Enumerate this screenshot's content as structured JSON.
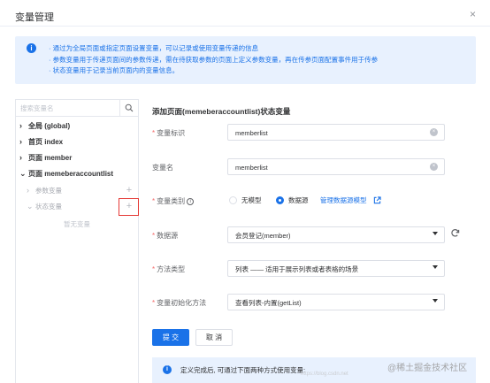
{
  "dialog": {
    "title": "变量管理",
    "close_glyph": "×"
  },
  "info": {
    "icon_glyph": "i",
    "lines": [
      "· 通过为全局页面或指定页面设置变量，可以记录或使用变量传递的信息",
      "· 参数变量用于传递页面间的参数传递，需在待获取参数的页面上定义参数变量，再在传参页面配置事件用于传参",
      "· 状态变量用于记录当前页面内的变量信息。"
    ]
  },
  "tree": {
    "search_placeholder": "搜索变量名",
    "nodes": [
      {
        "arrow": "›",
        "label": "全局 (global)"
      },
      {
        "arrow": "›",
        "label": "首页 index"
      },
      {
        "arrow": "›",
        "label": "页面 member"
      },
      {
        "arrow": "⌄",
        "label": "页面 memeberaccountlist"
      }
    ],
    "children": [
      {
        "arrow": "›",
        "label": "参数变量",
        "plus": "+"
      },
      {
        "arrow": "⌄",
        "label": "状态变量",
        "plus": "+"
      }
    ],
    "empty_text": "暂无变量"
  },
  "form": {
    "title": "添加页面(memeberaccountlist)状态变量",
    "required_mark": "*",
    "fields": {
      "identifier": {
        "label": "变量标识",
        "value": "memberlist"
      },
      "name": {
        "label": "变量名",
        "value": "memberlist"
      },
      "category": {
        "label": "变量类别",
        "options": [
          "无模型",
          "数据源"
        ],
        "selected": "数据源",
        "link": "管理数据源模型"
      },
      "datasource": {
        "label": "数据源",
        "value": "会员登记(member)"
      },
      "method": {
        "label": "方法类型",
        "value": "列表 —— 适用于展示列表或者表格的场景"
      },
      "init": {
        "label": "变量初始化方法",
        "value": "查看列表-内置(getList)"
      }
    },
    "buttons": {
      "submit": "提 交",
      "cancel": "取 消"
    },
    "tip": "定义完成后, 可通过下面两种方式使用变量:"
  },
  "watermark": {
    "text": "@稀土掘金技术社区",
    "url": "https://blog.csdn.net"
  },
  "colors": {
    "primary": "#1a72e8",
    "required": "#f56c6c",
    "highlight_box": "#e53935",
    "info_bg": "#e8f1fe"
  }
}
